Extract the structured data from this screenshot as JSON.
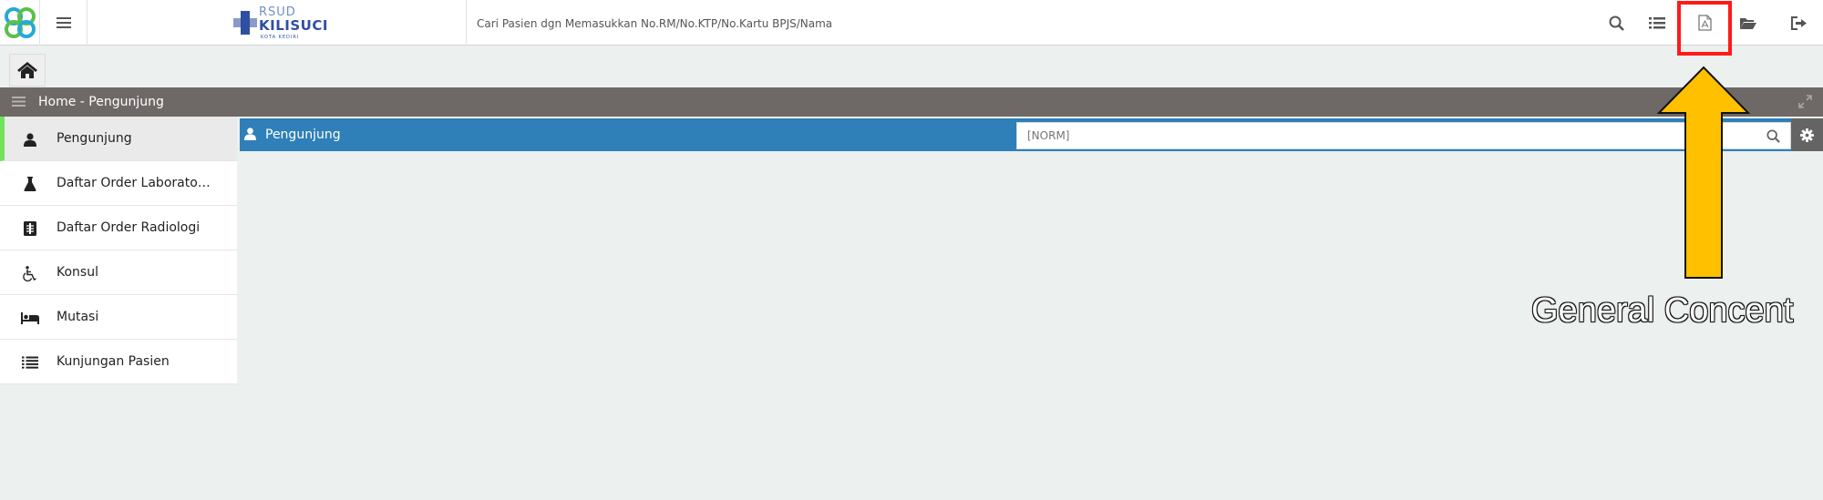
{
  "topbar": {
    "logo": {
      "line1": "RSUD",
      "line2": "KILISUCI",
      "line3": "KOTA KEDIRI"
    },
    "search_placeholder": "Cari Pasien dgn Memasukkan No.RM/No.KTP/No.Kartu BPJS/Nama",
    "icons": [
      "search-icon",
      "list-icon",
      "pdf-file-icon",
      "folder-open-icon",
      "sign-out-icon"
    ]
  },
  "breadcrumb": {
    "text": "Home - Pengunjung"
  },
  "sidebar": {
    "items": [
      {
        "label": "Pengunjung",
        "icon": "user-icon",
        "active": true
      },
      {
        "label": "Daftar Order Laboratorium",
        "icon": "flask-icon"
      },
      {
        "label": "Daftar Order Radiologi",
        "icon": "xray-icon"
      },
      {
        "label": "Konsul",
        "icon": "wheelchair-icon"
      },
      {
        "label": "Mutasi",
        "icon": "bed-icon"
      },
      {
        "label": "Kunjungan Pasien",
        "icon": "list-icon"
      }
    ]
  },
  "panel": {
    "title": "Pengunjung",
    "norm_placeholder": "[NORM]"
  },
  "annotation": {
    "text": "General Concent"
  },
  "colors": {
    "panel_blue": "#2f7fb8",
    "breadcrumb_gray": "#6e6867",
    "active_green": "#6fe35a",
    "highlight_red": "#ff1a1a",
    "arrow_yellow": "#ffc000"
  }
}
